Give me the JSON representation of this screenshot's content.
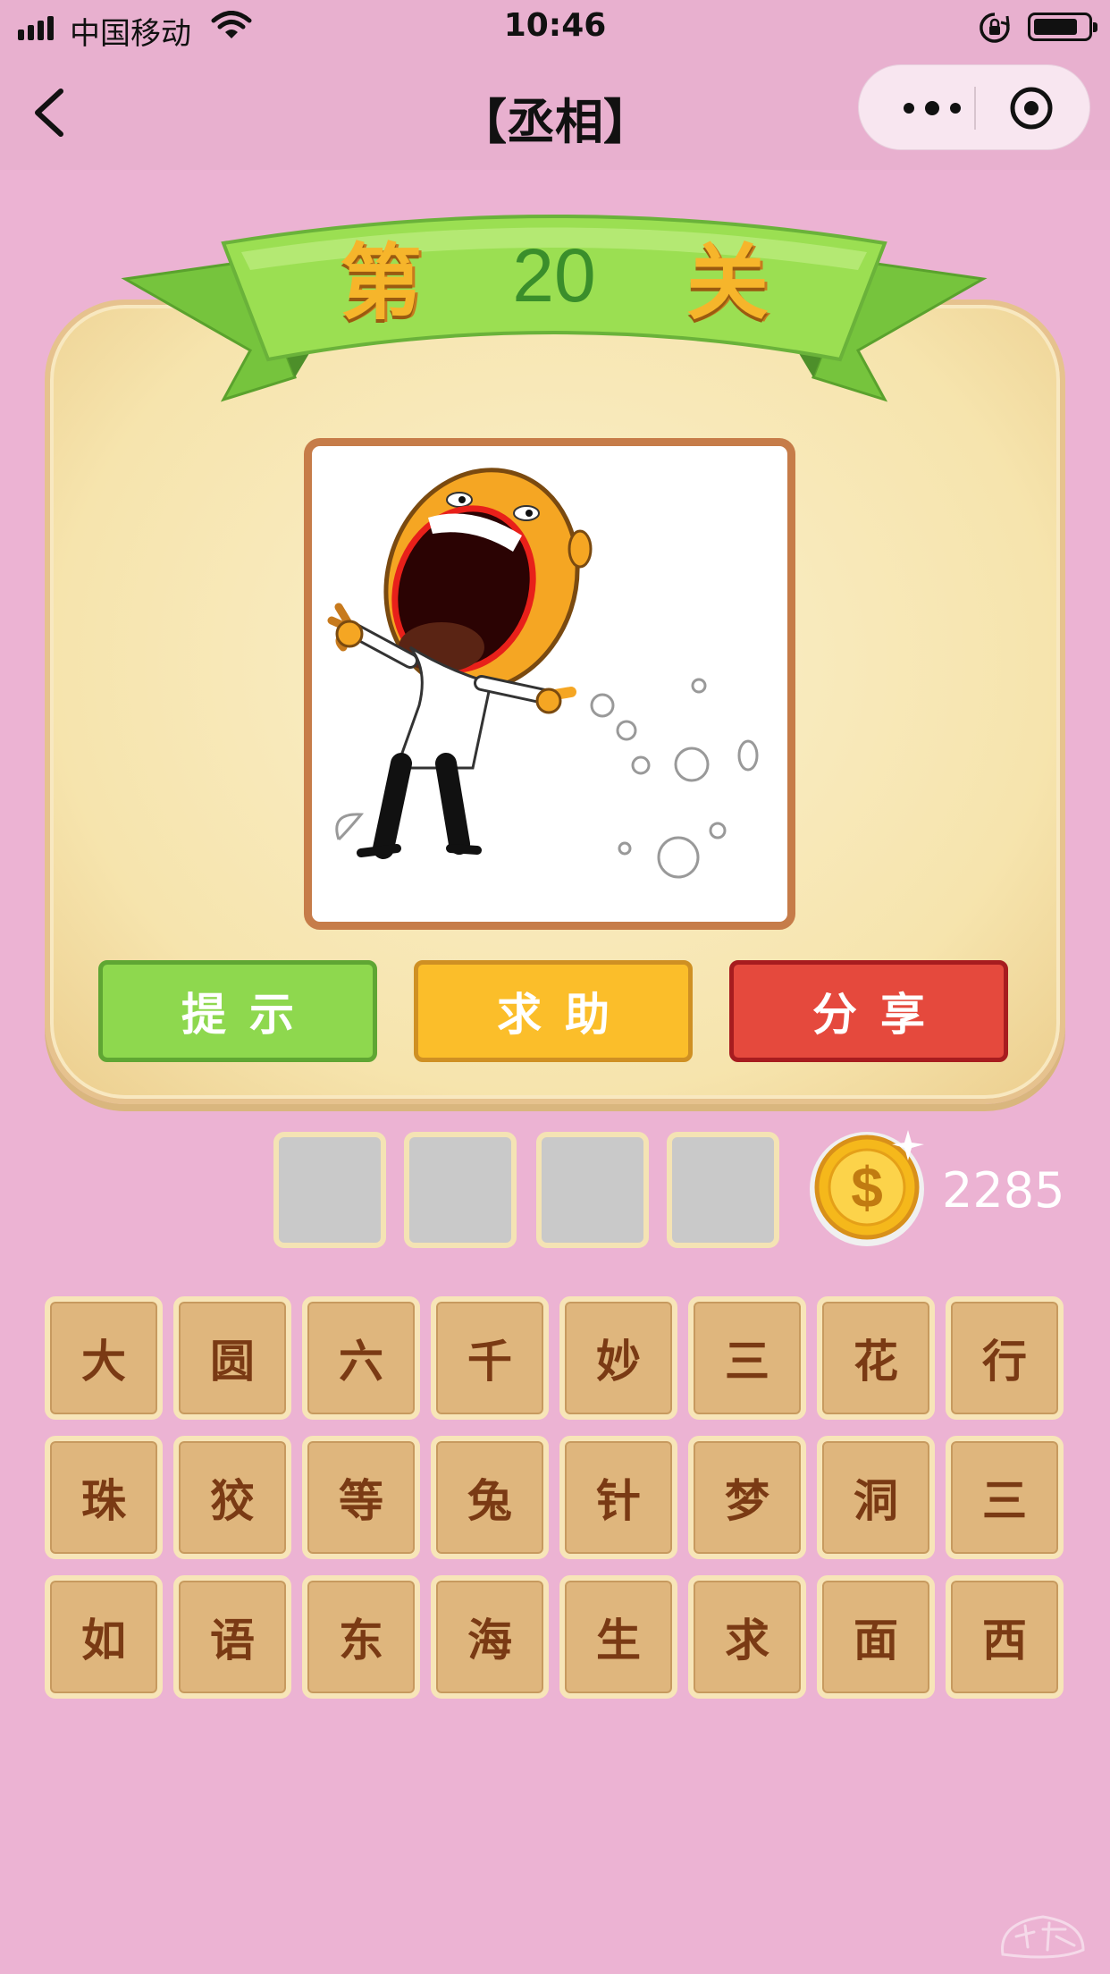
{
  "status_bar": {
    "carrier": "中国移动",
    "time": "10:46"
  },
  "nav": {
    "title": "【丞相】"
  },
  "level": {
    "prefix": "第",
    "number": "20",
    "suffix": "关"
  },
  "actions": {
    "hint": "提示",
    "help": "求助",
    "share": "分享"
  },
  "answer_slots": [
    "",
    "",
    "",
    ""
  ],
  "coins": "2285",
  "characters": [
    [
      "大",
      "圆",
      "六",
      "千",
      "妙",
      "三",
      "花",
      "行"
    ],
    [
      "珠",
      "狡",
      "等",
      "兔",
      "针",
      "梦",
      "洞",
      "三"
    ],
    [
      "如",
      "语",
      "东",
      "海",
      "生",
      "求",
      "面",
      "西"
    ]
  ],
  "colors": {
    "background": "#ecb3d3",
    "hint_button": "#8ed84e",
    "help_button": "#fbbe2a",
    "share_button": "#e5493d",
    "tile": "#dfb67d"
  },
  "icons": [
    "back-icon",
    "more-icon",
    "close-icon",
    "coin-icon",
    "wifi-icon",
    "rotation-lock-icon",
    "battery-icon"
  ]
}
